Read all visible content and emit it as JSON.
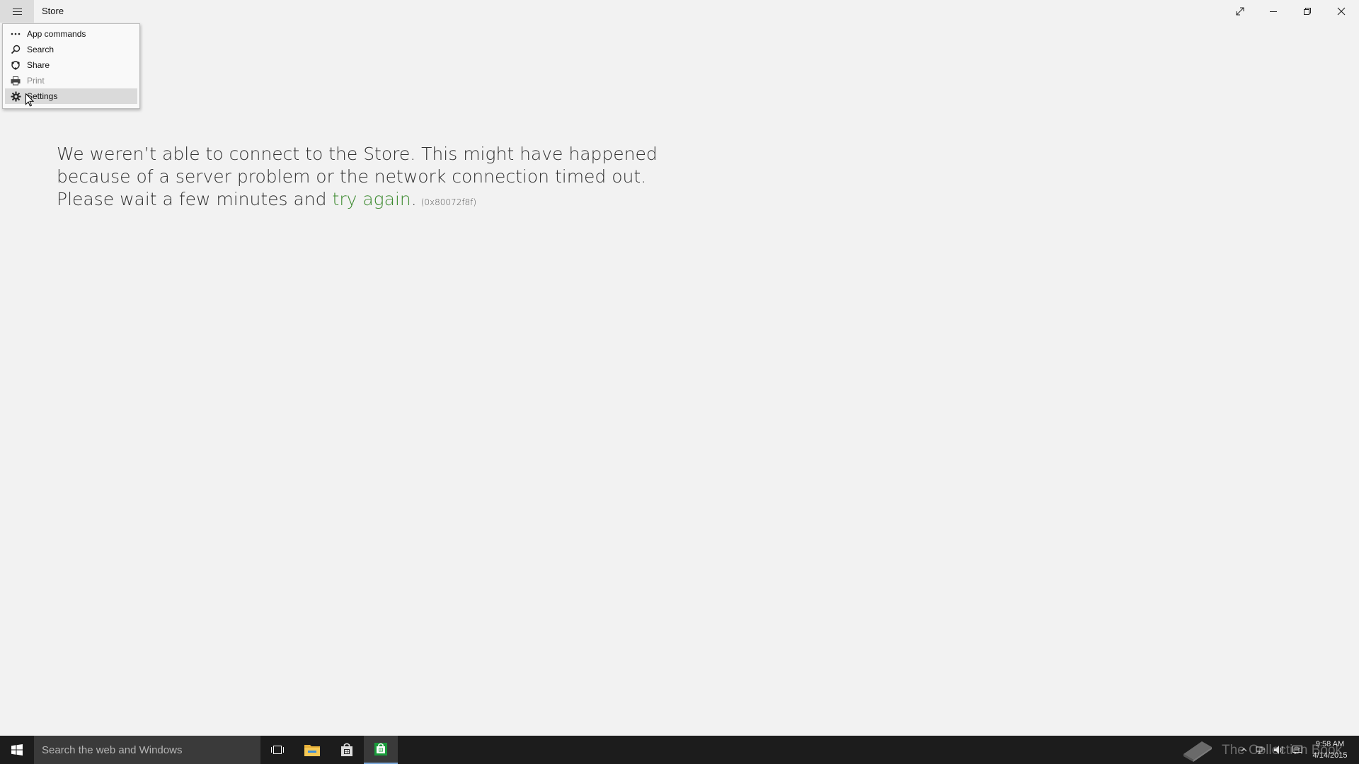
{
  "window": {
    "title": "Store",
    "hamburger_icon": "hamburger-menu-icon",
    "controls": [
      "fullscreen-icon",
      "minimize-icon",
      "restore-icon",
      "close-icon"
    ]
  },
  "menu": {
    "items": [
      {
        "label": "App commands",
        "icon": "more-dots-icon",
        "disabled": false
      },
      {
        "label": "Search",
        "icon": "search-icon",
        "disabled": false
      },
      {
        "label": "Share",
        "icon": "share-icon",
        "disabled": false
      },
      {
        "label": "Print",
        "icon": "printer-icon",
        "disabled": true
      },
      {
        "label": "Settings",
        "icon": "gear-icon",
        "disabled": false,
        "hovered": true
      }
    ]
  },
  "message": {
    "line1": "We weren’t able to connect to the Store. This might have happened",
    "line2": "because of a server problem or the network connection timed out.",
    "line3_prefix": "Please wait a few minutes and ",
    "link": "try again",
    "line3_suffix": ".",
    "error_code": "(0x80072f8f)",
    "link_color": "#3c8a2f"
  },
  "taskbar": {
    "search_placeholder": "Search the web and Windows",
    "buttons": [
      "task-view-icon",
      "file-explorer-icon",
      "store-bag-icon",
      "store-app-icon"
    ],
    "watermark_text": "The Collection Book",
    "clock_time": "9:58 AM",
    "clock_date": "4/14/2015"
  }
}
